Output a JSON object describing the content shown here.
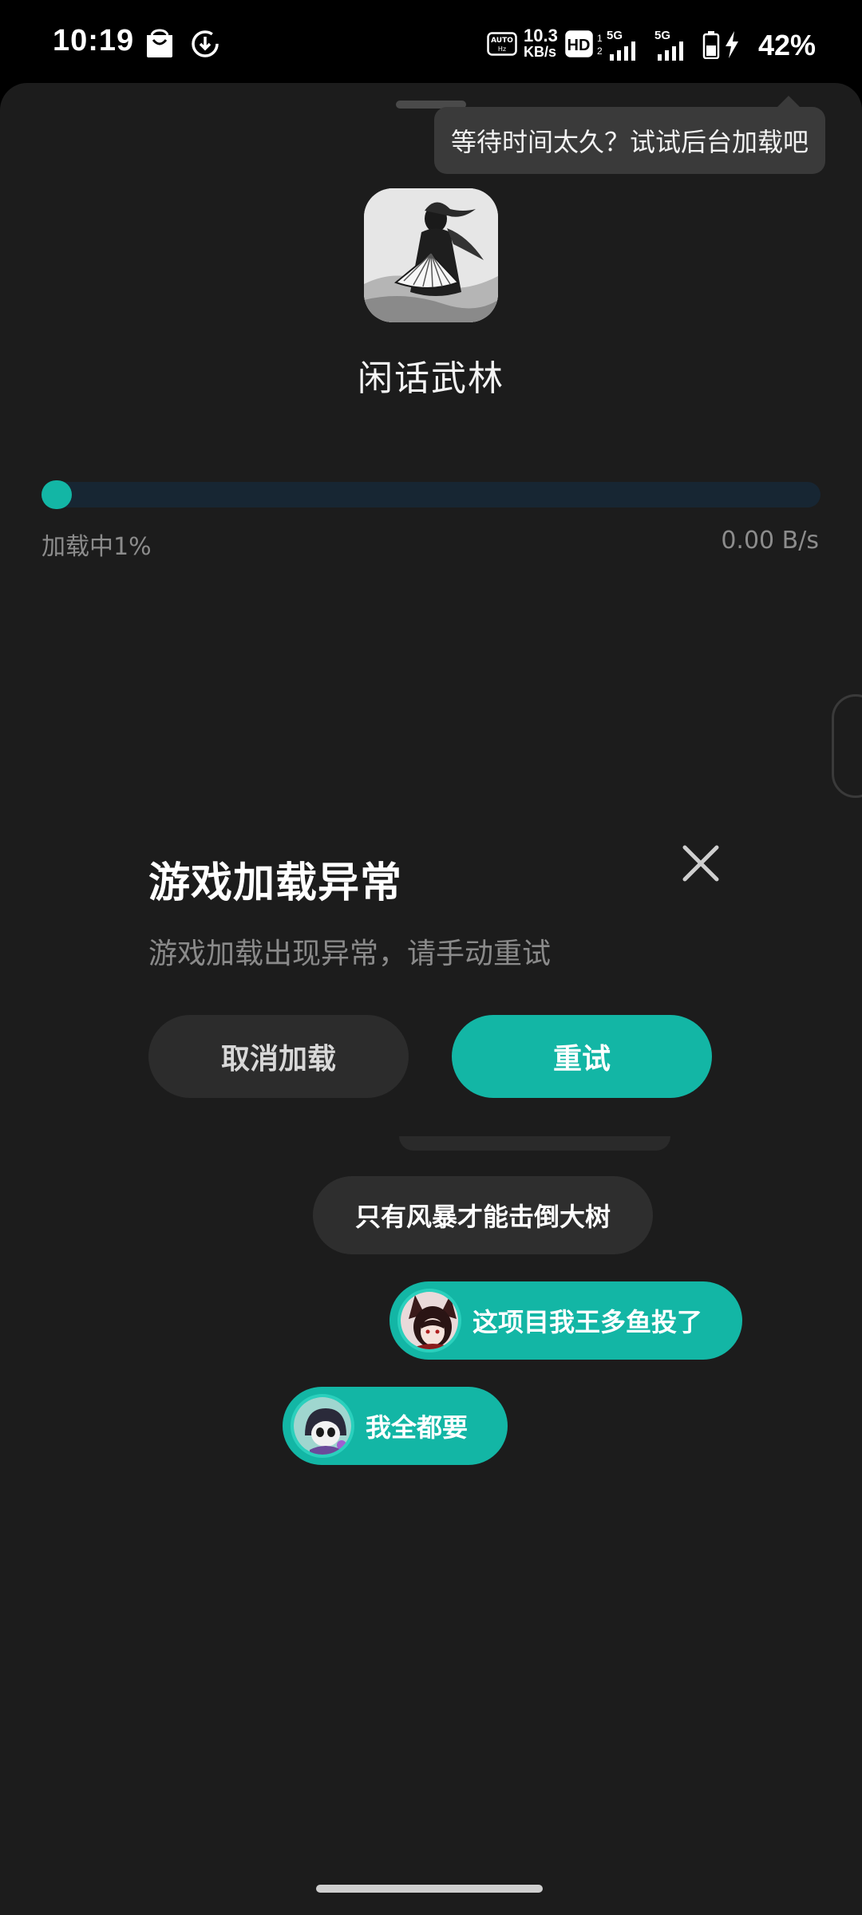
{
  "status_bar": {
    "time": "10:19",
    "speed_value": "10.3",
    "speed_unit": "KB/s",
    "network_label_1": "5G",
    "network_label_2": "5G",
    "battery_percent": "42%",
    "icons": [
      "shopping-bag-icon",
      "download-icon",
      "auto-hz-icon",
      "hd-icon",
      "signal-icon",
      "signal-icon",
      "battery-icon",
      "charging-icon"
    ]
  },
  "loader": {
    "tooltip": "等待时间太久？试试后台加载吧",
    "game_name": "闲话武林",
    "progress_text": "加载中1%",
    "progress_fraction": 0.01,
    "speed_text": "0.00 B/s"
  },
  "dialog": {
    "title": "游戏加载异常",
    "message": "游戏加载出现异常，请手动重试",
    "cancel_label": "取消加载",
    "retry_label": "重试"
  },
  "danmaku": [
    {
      "text": "只有风暴才能击倒大树",
      "style": "gray",
      "avatar": null
    },
    {
      "text": "这项目我王多鱼投了",
      "style": "teal",
      "avatar": "fox-girl-avatar"
    },
    {
      "text": "我全都要",
      "style": "teal",
      "avatar": "skull-character-avatar"
    }
  ],
  "colors": {
    "accent": "#13b6a5",
    "sheet_bg": "#1c1c1c",
    "track": "#172633",
    "muted_text": "#8c8c8c"
  }
}
